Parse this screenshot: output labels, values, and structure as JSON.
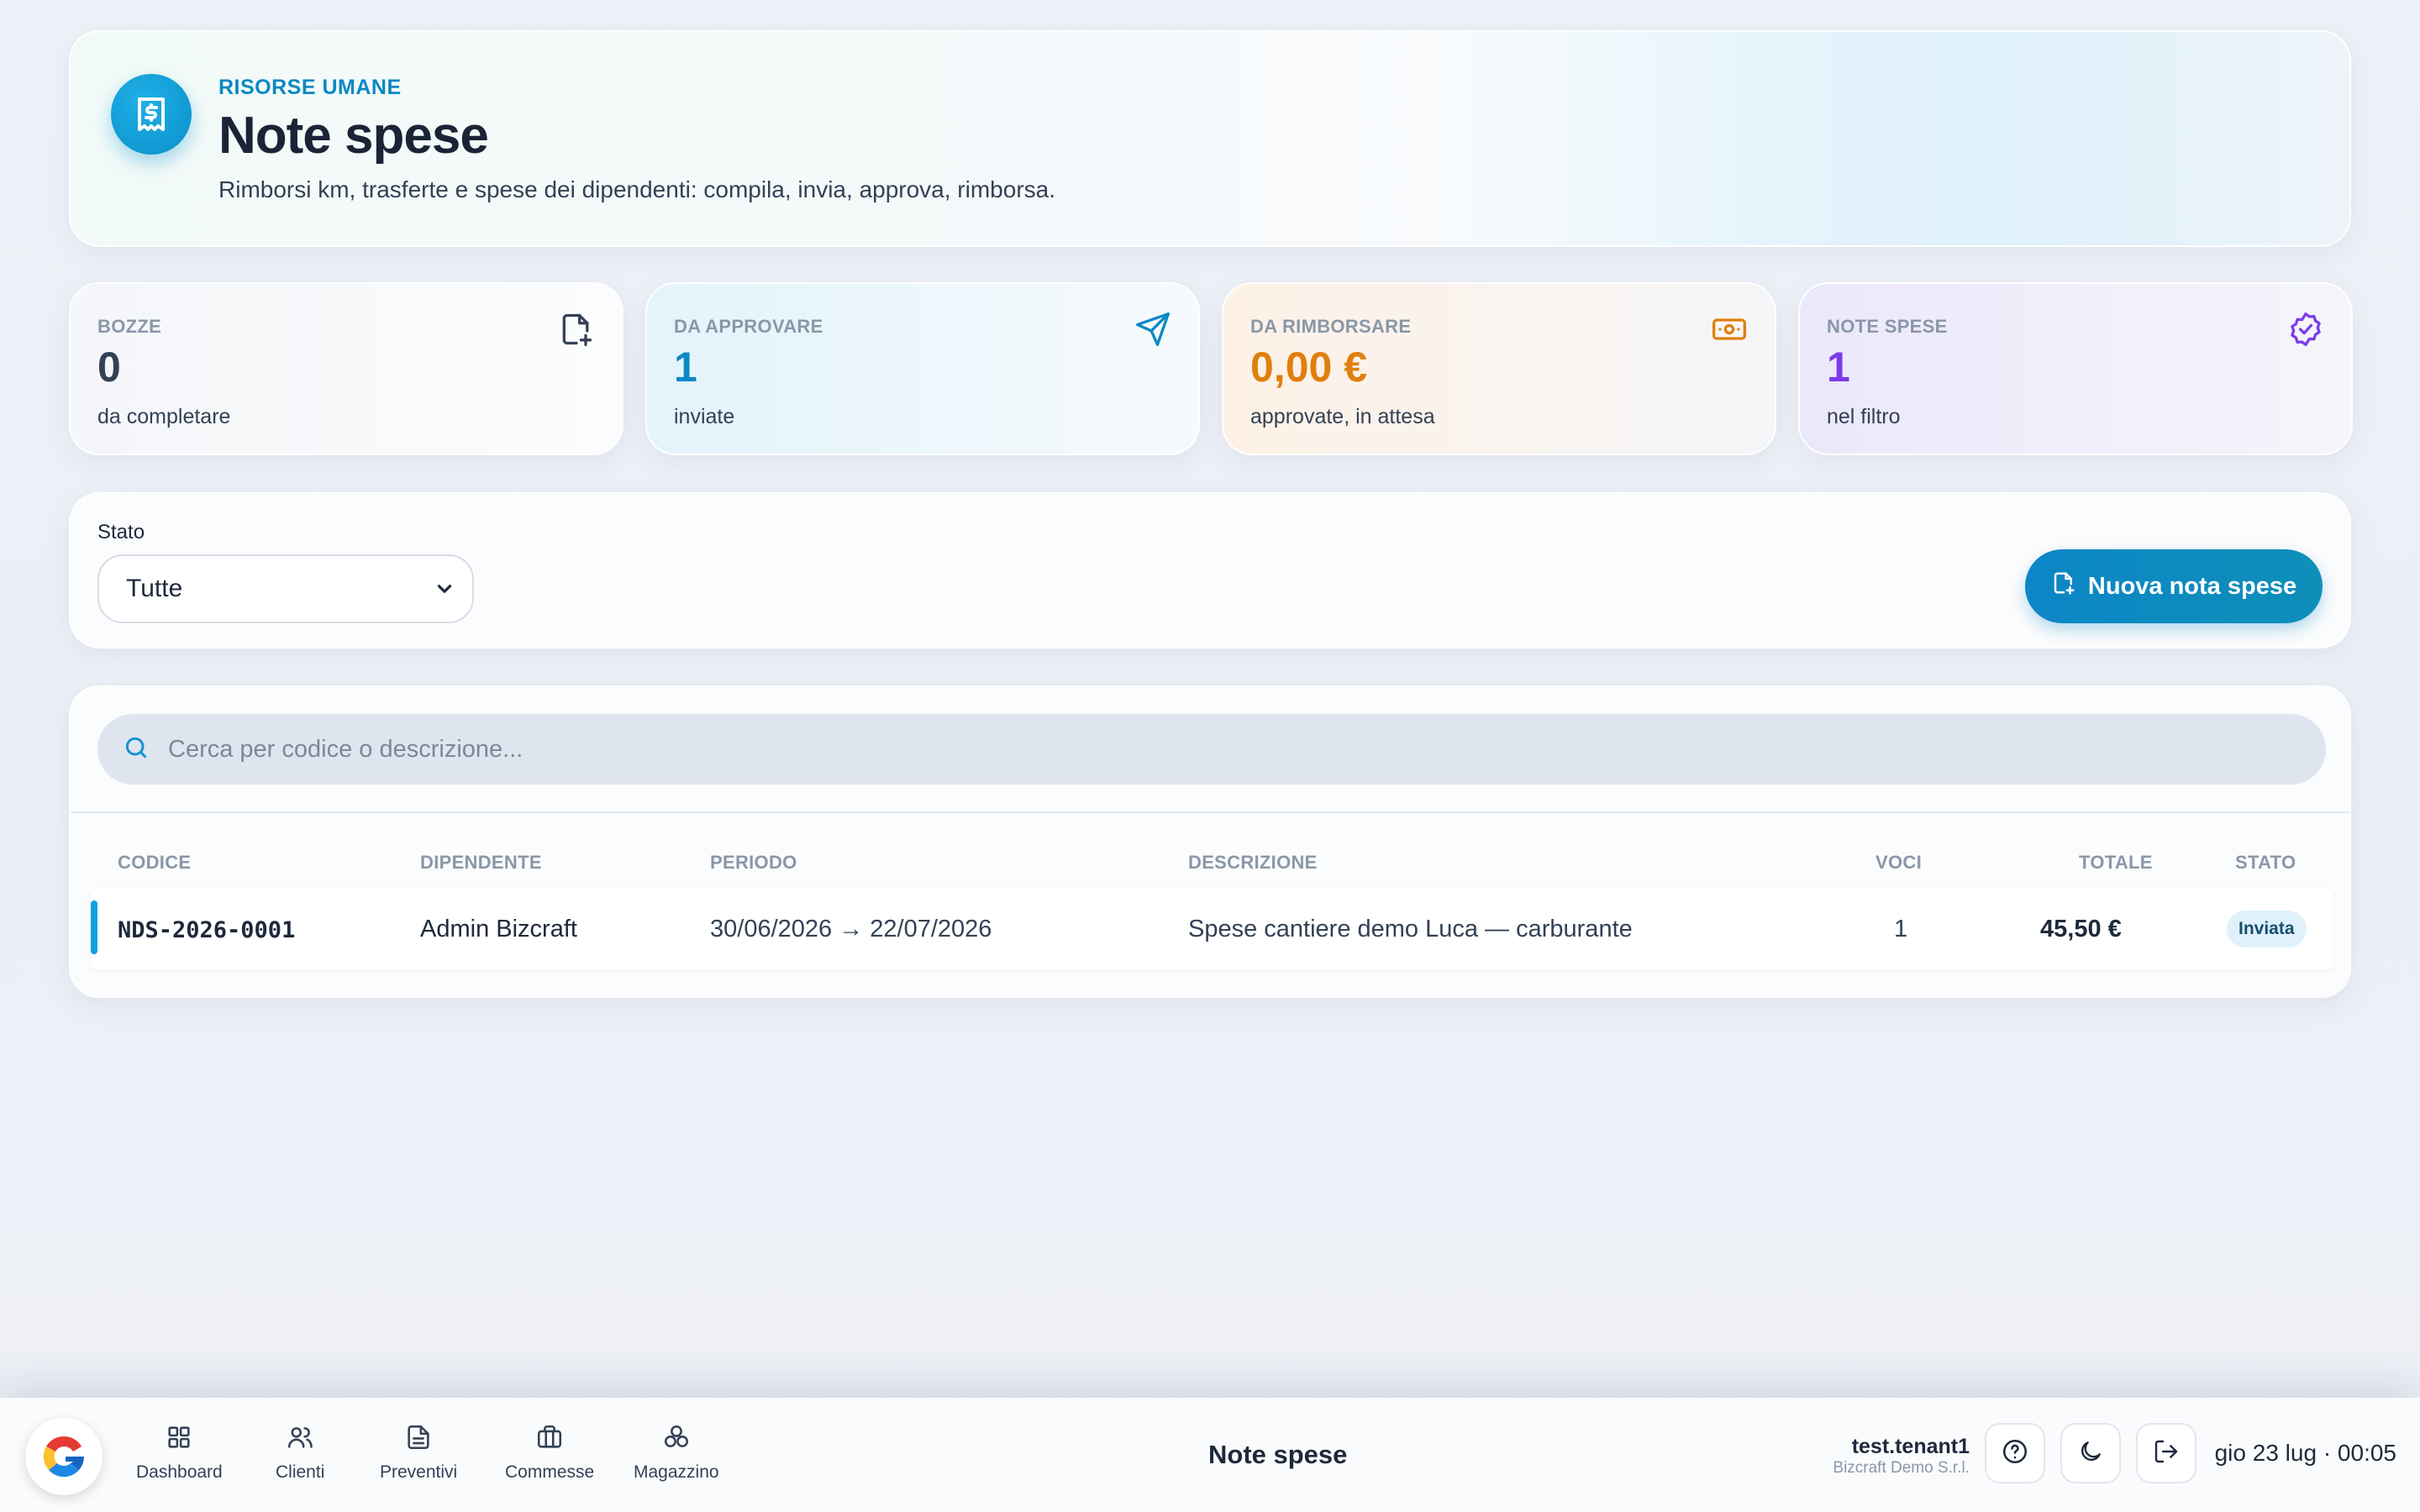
{
  "header": {
    "kicker": "RISORSE UMANE",
    "title": "Note spese",
    "subtitle": "Rimborsi km, trasferte e spese dei dipendenti: compila, invia, approva, rimborsa.",
    "icon": "receipt-dollar-icon",
    "accent": "#0b88c4"
  },
  "stats": [
    {
      "label": "BOZZE",
      "value": "0",
      "sub": "da completare",
      "icon": "file-plus-icon",
      "color": "#334155"
    },
    {
      "label": "DA APPROVARE",
      "value": "1",
      "sub": "inviate",
      "icon": "send-icon",
      "color": "#0b88c4"
    },
    {
      "label": "DA RIMBORSARE",
      "value": "0,00 €",
      "sub": "approvate, in attesa",
      "icon": "banknote-icon",
      "color": "#e07f0c"
    },
    {
      "label": "NOTE SPESE",
      "value": "1",
      "sub": "nel filtro",
      "icon": "badge-check-icon",
      "color": "#7c3aed"
    }
  ],
  "filter": {
    "label": "Stato",
    "selected": "Tutte",
    "new_button": "Nuova nota spese"
  },
  "search": {
    "placeholder": "Cerca per codice o descrizione..."
  },
  "table": {
    "columns": [
      "CODICE",
      "DIPENDENTE",
      "PERIODO",
      "DESCRIZIONE",
      "VOCI",
      "TOTALE",
      "STATO"
    ],
    "rows": [
      {
        "code": "NDS-2026-0001",
        "employee": "Admin Bizcraft",
        "period": "30/06/2026 → 22/07/2026",
        "description": "Spese cantiere demo Luca — carburante",
        "items": "1",
        "total": "45,50 €",
        "status": "Inviata"
      }
    ]
  },
  "bottombar": {
    "nav": [
      {
        "label": "Dashboard",
        "icon": "grid-icon"
      },
      {
        "label": "Clienti",
        "icon": "users-icon"
      },
      {
        "label": "Preventivi",
        "icon": "document-icon"
      },
      {
        "label": "Commesse",
        "icon": "briefcase-icon"
      },
      {
        "label": "Magazzino",
        "icon": "boxes-icon"
      }
    ],
    "page_title": "Note spese",
    "user": "test.tenant1",
    "company": "Bizcraft Demo S.r.l.",
    "datetime": "gio 23 lug · 00:05"
  }
}
